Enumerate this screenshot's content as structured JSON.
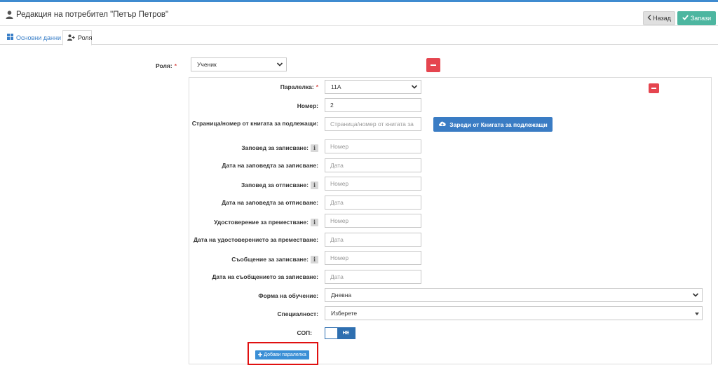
{
  "header": {
    "title": "Редакция на потребител \"Петър Петров\"",
    "back_label": "Назад",
    "save_label": "Запази"
  },
  "tabs": [
    {
      "label": "Основни данни"
    },
    {
      "label": "Роля"
    }
  ],
  "role": {
    "label": "Роля:",
    "required_mark": "*",
    "value": "Ученик"
  },
  "form": {
    "class_label": "Паралелка:",
    "class_required": "*",
    "class_value": "11А",
    "number_label": "Номер:",
    "number_value": "2",
    "page_label": "Страница/номер от книгата за подлежащи:",
    "page_placeholder": "Страница/номер от книгата за",
    "load_button": "Зареди от Книгата за подлежащи",
    "enroll_order_label": "Заповед за записване:",
    "enroll_order_placeholder": "Номер",
    "enroll_order_date_label": "Дата на заповедта за записване:",
    "enroll_order_date_placeholder": "Дата",
    "unenroll_order_label": "Заповед за отписване:",
    "unenroll_order_placeholder": "Номер",
    "unenroll_order_date_label": "Дата на заповедта за отписване:",
    "unenroll_order_date_placeholder": "Дата",
    "transfer_cert_label": "Удостоверение за преместване:",
    "transfer_cert_placeholder": "Номер",
    "transfer_cert_date_label": "Дата на удостоверението за преместване:",
    "transfer_cert_date_placeholder": "Дата",
    "enroll_msg_label": "Съобщение за записване:",
    "enroll_msg_placeholder": "Номер",
    "enroll_msg_date_label": "Дата на съобщението за записване:",
    "enroll_msg_date_placeholder": "Дата",
    "study_form_label": "Форма на обучение:",
    "study_form_value": "Дневна",
    "specialty_label": "Специалност:",
    "specialty_value": "Изберете",
    "sop_label": "СОП:",
    "sop_toggle_value": "НЕ",
    "add_class_button": "Добави паралелка",
    "info_glyph": "i"
  },
  "colors": {
    "accent_blue": "#3a7cc4",
    "save_green": "#4db6a0",
    "remove_red": "#e5454f",
    "highlight_red": "#e01010"
  },
  "icons": [
    "user-icon",
    "chevron-left-icon",
    "check-icon",
    "grid-icon",
    "user-plus-icon",
    "chevron-down-icon",
    "minus-icon",
    "info-icon",
    "cloud-download-icon",
    "plus-icon"
  ]
}
